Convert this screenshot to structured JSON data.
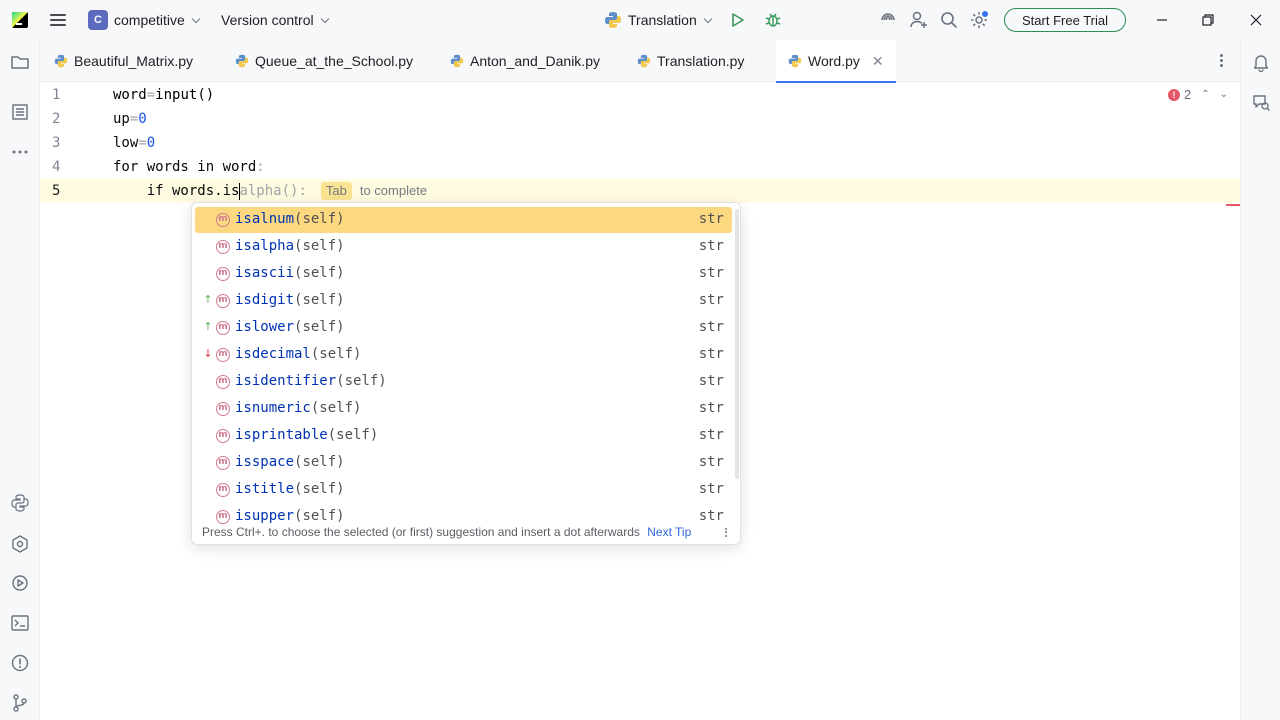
{
  "titlebar": {
    "project_initial": "C",
    "project_name": "competitive",
    "version_control": "Version control",
    "run_config": "Translation",
    "trial_button": "Start Free Trial"
  },
  "tabs": [
    {
      "label": "Beautiful_Matrix.py"
    },
    {
      "label": "Queue_at_the_School.py"
    },
    {
      "label": "Anton_and_Danik.py"
    },
    {
      "label": "Translation.py"
    },
    {
      "label": "Word.py",
      "active": true
    }
  ],
  "editor": {
    "lines": [
      {
        "n": "1",
        "text": "word=input()"
      },
      {
        "n": "2",
        "text": "up=0"
      },
      {
        "n": "3",
        "text": "low=0"
      },
      {
        "n": "4",
        "text": "for words in word:"
      },
      {
        "n": "5",
        "typed": "    if words.is",
        "ghost": "alpha():",
        "tab_key": "Tab",
        "tab_hint": "to complete"
      }
    ],
    "error_count": "2"
  },
  "completion": {
    "items": [
      {
        "name": "isalnum",
        "params": "(self)",
        "type": "str",
        "arrow": ""
      },
      {
        "name": "isalpha",
        "params": "(self)",
        "type": "str",
        "arrow": ""
      },
      {
        "name": "isascii",
        "params": "(self)",
        "type": "str",
        "arrow": ""
      },
      {
        "name": "isdigit",
        "params": "(self)",
        "type": "str",
        "arrow": "up"
      },
      {
        "name": "islower",
        "params": "(self)",
        "type": "str",
        "arrow": "up"
      },
      {
        "name": "isdecimal",
        "params": "(self)",
        "type": "str",
        "arrow": "down"
      },
      {
        "name": "isidentifier",
        "params": "(self)",
        "type": "str",
        "arrow": ""
      },
      {
        "name": "isnumeric",
        "params": "(self)",
        "type": "str",
        "arrow": ""
      },
      {
        "name": "isprintable",
        "params": "(self)",
        "type": "str",
        "arrow": ""
      },
      {
        "name": "isspace",
        "params": "(self)",
        "type": "str",
        "arrow": ""
      },
      {
        "name": "istitle",
        "params": "(self)",
        "type": "str",
        "arrow": ""
      },
      {
        "name": "isupper",
        "params": "(self)",
        "type": "str",
        "arrow": ""
      }
    ],
    "footer_text": "Press Ctrl+. to choose the selected (or first) suggestion and insert a dot afterwards",
    "footer_tip": "Next Tip"
  },
  "colors": {
    "selected_item": "#fcd980",
    "accent": "#3574f0",
    "error": "#e55765",
    "trial_border": "#2e8d50"
  }
}
